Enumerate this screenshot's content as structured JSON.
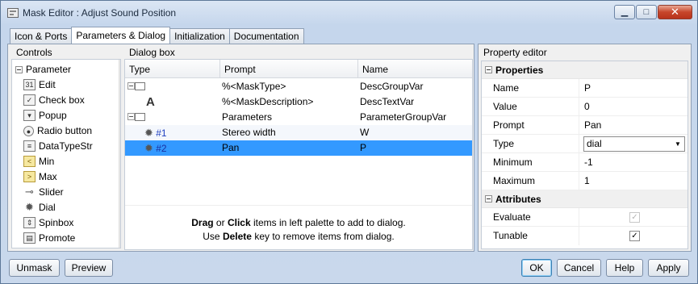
{
  "window": {
    "title": "Mask Editor : Adjust Sound Position",
    "minimize_glyph": "▁",
    "maximize_glyph": "□",
    "close_glyph": "✕"
  },
  "tabs": [
    {
      "label": "Icon & Ports"
    },
    {
      "label": "Parameters & Dialog",
      "active": true
    },
    {
      "label": "Initialization"
    },
    {
      "label": "Documentation"
    }
  ],
  "controls": {
    "title": "Controls",
    "group_label": "Parameter",
    "items": [
      {
        "label": "Edit",
        "icon": "edit-icon",
        "glyph": "31"
      },
      {
        "label": "Check box",
        "icon": "checkbox-icon",
        "glyph": "✓"
      },
      {
        "label": "Popup",
        "icon": "popup-icon",
        "glyph": "▾"
      },
      {
        "label": "Radio button",
        "icon": "radio-button-icon",
        "glyph": "●"
      },
      {
        "label": "DataTypeStr",
        "icon": "datatype-icon",
        "glyph": "≡"
      },
      {
        "label": "Min",
        "icon": "min-icon",
        "glyph": "<"
      },
      {
        "label": "Max",
        "icon": "max-icon",
        "glyph": ">"
      },
      {
        "label": "Slider",
        "icon": "slider-icon",
        "glyph": "⊸"
      },
      {
        "label": "Dial",
        "icon": "dial-icon",
        "glyph": "✹"
      },
      {
        "label": "Spinbox",
        "icon": "spinbox-icon",
        "glyph": "⇕"
      },
      {
        "label": "Promote",
        "icon": "promote-icon",
        "glyph": "▤"
      }
    ]
  },
  "dialog_box": {
    "title": "Dialog box",
    "columns": [
      "Type",
      "Prompt",
      "Name"
    ],
    "rows": [
      {
        "type": "",
        "prompt": "%<MaskType>",
        "name": "DescGroupVar"
      },
      {
        "type": "A",
        "prompt": "%<MaskDescription>",
        "name": "DescTextVar"
      },
      {
        "type": "",
        "prompt": "Parameters",
        "name": "ParameterGroupVar"
      },
      {
        "type": "#1",
        "prompt": "Stereo width",
        "name": "W"
      },
      {
        "type": "#2",
        "prompt": "Pan",
        "name": "P",
        "selected": true
      }
    ],
    "hint": {
      "drag": "Drag",
      "or": " or ",
      "click": "Click",
      "line1_rest": " items in left palette to add to dialog.",
      "use": "Use ",
      "delete": "Delete",
      "line2_rest": " key to remove items from dialog."
    }
  },
  "property_editor": {
    "title": "Property editor",
    "properties_section": "Properties",
    "properties": [
      {
        "key": "Name",
        "value": "P"
      },
      {
        "key": "Value",
        "value": "0"
      },
      {
        "key": "Prompt",
        "value": "Pan"
      },
      {
        "key": "Type",
        "value": "dial"
      },
      {
        "key": "Minimum",
        "value": "-1"
      },
      {
        "key": "Maximum",
        "value": "1"
      }
    ],
    "attributes_section": "Attributes",
    "attributes": [
      {
        "key": "Evaluate",
        "checked": true,
        "disabled": true
      },
      {
        "key": "Tunable",
        "checked": true,
        "disabled": false
      }
    ]
  },
  "buttons": {
    "unmask": "Unmask",
    "preview": "Preview",
    "ok": "OK",
    "cancel": "Cancel",
    "help": "Help",
    "apply": "Apply"
  }
}
